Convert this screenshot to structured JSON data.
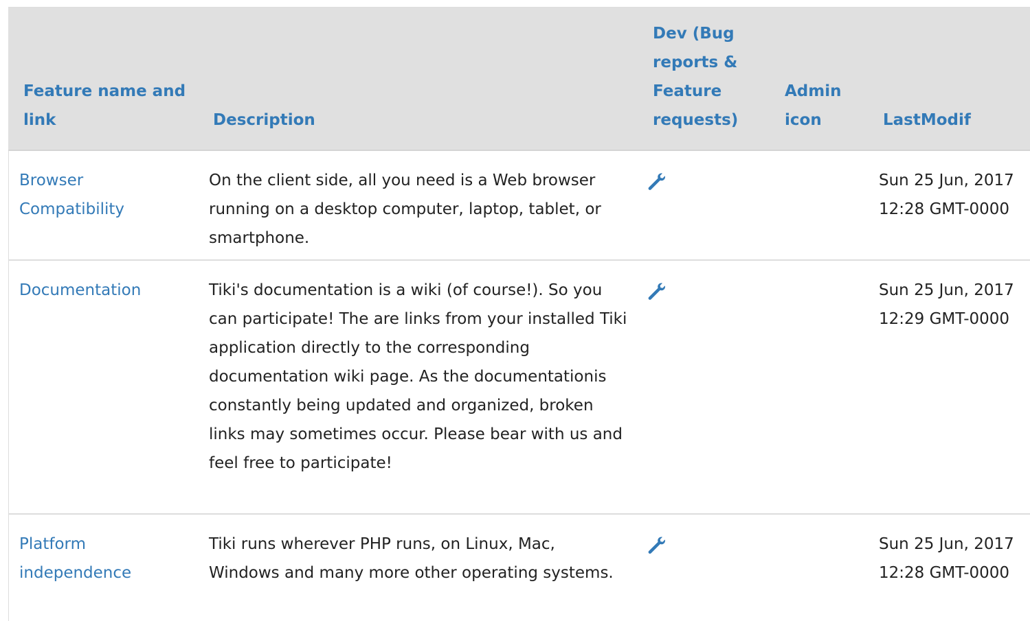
{
  "table": {
    "headers": {
      "name": "Feature name and link",
      "description": "Description",
      "dev": "Dev (Bug reports & Feature requests)",
      "admin": "Admin icon",
      "lastmodif": "LastModif"
    },
    "rows": [
      {
        "name": "Browser Compatibility",
        "description": "On the client side, all you need is a Web browser running on a desktop computer, laptop, tablet, or smartphone.",
        "dev_icon": "wrench-icon",
        "admin": "",
        "lastmodif": "Sun 25 Jun, 2017 12:28 GMT-0000"
      },
      {
        "name": "Documentation",
        "description": "Tiki's documentation is a wiki (of course!). So you can participate! The are links from your installed Tiki application directly to the corresponding documentation wiki page. As the documentationis constantly being updated and organized, broken links may sometimes occur. Please bear with us and feel free to participate!",
        "dev_icon": "wrench-icon",
        "admin": "",
        "lastmodif": "Sun 25 Jun, 2017 12:29 GMT-0000"
      },
      {
        "name": "Platform independence",
        "description": "Tiki runs wherever PHP runs, on Linux, Mac, Windows and many more other operating systems.",
        "dev_icon": "wrench-icon",
        "admin": "",
        "lastmodif": "Sun 25 Jun, 2017 12:28 GMT-0000"
      }
    ]
  },
  "colors": {
    "link": "#337ab7",
    "header_bg": "#e0e0e0",
    "text": "#222222",
    "border": "#dddddd"
  }
}
